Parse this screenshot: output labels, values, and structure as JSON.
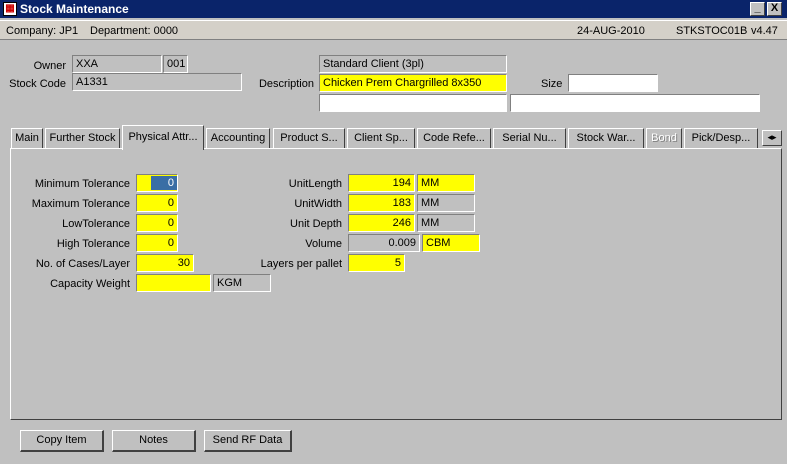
{
  "window": {
    "title": "Stock Maintenance",
    "icon": "app-icon"
  },
  "titlebar_buttons": {
    "minimize": "_",
    "close": "X"
  },
  "info": {
    "company": "Company: JP1",
    "department": "Department: 0000",
    "date": "24-AUG-2010",
    "program": "STKSTOC01B",
    "version": "v4.47"
  },
  "header": {
    "owner_label": "Owner",
    "owner_code": "XXA",
    "owner_num": "001",
    "owner_name": "Standard Client (3pl)",
    "stock_code_label": "Stock Code",
    "stock_code": "A1331",
    "description_label": "Description",
    "description": "Chicken Prem Chargrilled 8x350",
    "description2": "",
    "description3": "",
    "size_label": "Size",
    "size": ""
  },
  "tabs": [
    "Main",
    "Further Stock",
    "Physical Attr...",
    "Accounting",
    "Product S...",
    "Client Sp...",
    "Code Refe...",
    "Serial Nu...",
    "Stock War...",
    "Bond",
    "Pick/Desp..."
  ],
  "tab_scroll": "◂▸",
  "physical": {
    "min_tol_label": "Minimum Tolerance",
    "min_tol": "0",
    "max_tol_label": "Maximum Tolerance",
    "max_tol": "0",
    "low_tol_label": "LowTolerance",
    "low_tol": "0",
    "high_tol_label": "High Tolerance",
    "high_tol": "0",
    "cases_label": "No. of Cases/Layer",
    "cases": "30",
    "cap_weight_label": "Capacity Weight",
    "cap_weight": "",
    "cap_weight_unit": "KGM",
    "length_label": "UnitLength",
    "length": "194",
    "length_unit": "MM",
    "width_label": "UnitWidth",
    "width": "183",
    "width_unit": "MM",
    "depth_label": "Unit Depth",
    "depth": "246",
    "depth_unit": "MM",
    "volume_label": "Volume",
    "volume": "0.009",
    "volume_unit": "CBM",
    "layers_label": "Layers per pallet",
    "layers": "5"
  },
  "buttons": {
    "copy": "Copy Item",
    "notes": "Notes",
    "send_rf": "Send RF Data"
  },
  "colors": {
    "title_bar": "#0a246a",
    "required_field": "#ffff00",
    "background": "#c0c0c0"
  }
}
